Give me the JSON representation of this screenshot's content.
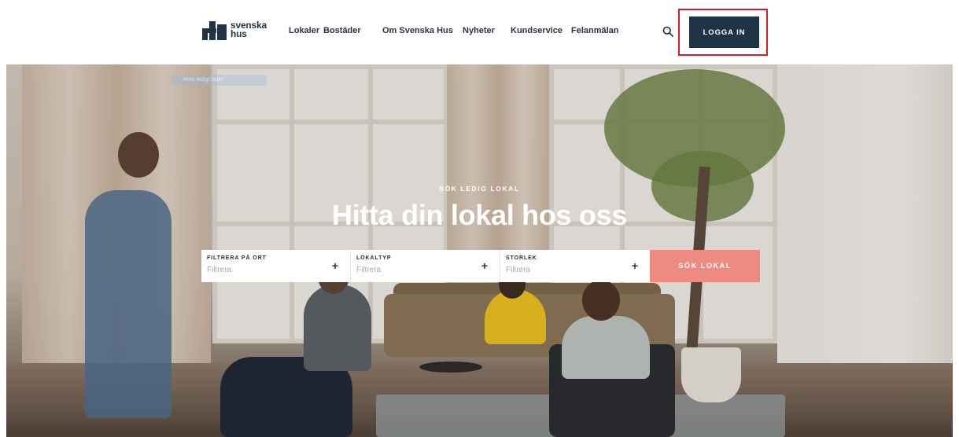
{
  "brand": {
    "name_line1": "svenska",
    "name_line2": "hus"
  },
  "nav": {
    "items": [
      {
        "label": "Lokaler"
      },
      {
        "label": "Bostäder"
      },
      {
        "label": "Om Svenska Hus"
      },
      {
        "label": "Nyheter"
      },
      {
        "label": "Kundservice"
      },
      {
        "label": "Felanmälan"
      }
    ],
    "search_icon": "search-icon",
    "login_label": "LOGGA IN",
    "highlight_color": "#d0212a"
  },
  "hero": {
    "ghost_chip": "Hitta ledigt lager",
    "eyebrow": "SÖK LEDIG LOKAL",
    "title": "Hitta din lokal hos oss"
  },
  "search": {
    "filters": [
      {
        "label": "FILTRERA PÅ ORT",
        "placeholder": "Filtrera",
        "icon": "plus-icon"
      },
      {
        "label": "LOKALTYP",
        "placeholder": "Filtrera",
        "icon": "plus-icon"
      },
      {
        "label": "STORLEK",
        "placeholder": "Filtrera",
        "icon": "plus-icon"
      }
    ],
    "submit_label": "SÖK LOKAL",
    "submit_color": "#ef8a80"
  },
  "colors": {
    "navy": "#1f3446",
    "text": "#2b3440"
  }
}
